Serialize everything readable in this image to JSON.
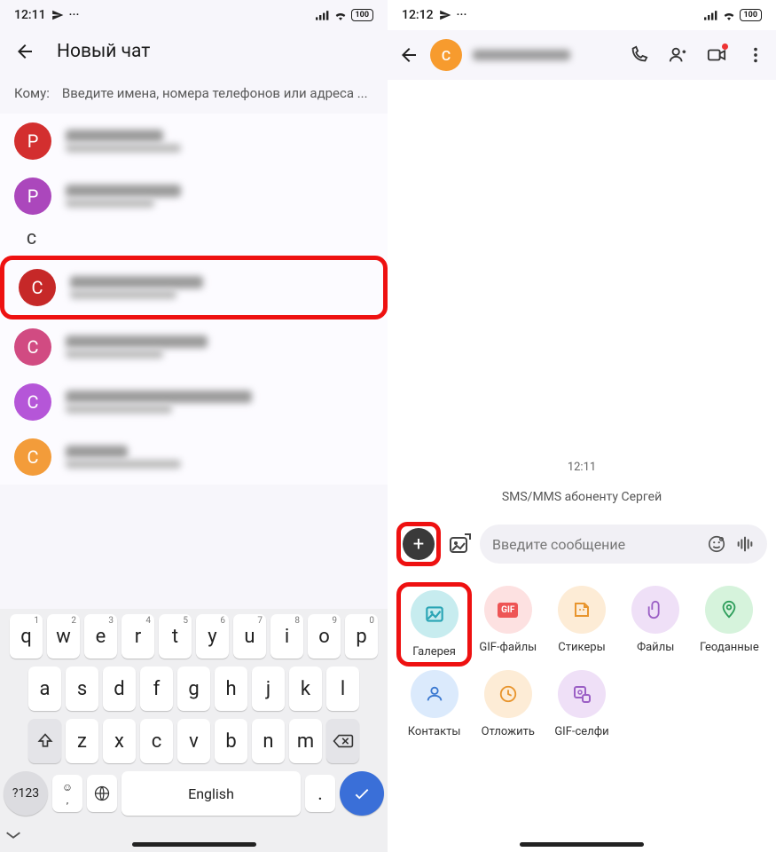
{
  "left": {
    "status": {
      "time": "12:11",
      "battery": "100"
    },
    "header": {
      "title": "Новый чат"
    },
    "to": {
      "label": "Кому:",
      "placeholder": "Введите имена, номера телефонов или адреса ..."
    },
    "section_letter": "С",
    "contacts": [
      {
        "letter": "Р",
        "color": "#d32f2f"
      },
      {
        "letter": "Р",
        "color": "#ab47bc"
      },
      {
        "letter": "С",
        "color": "#c62828",
        "highlight": true
      },
      {
        "letter": "С",
        "color": "#d14b82"
      },
      {
        "letter": "С",
        "color": "#b556d8"
      },
      {
        "letter": "С",
        "color": "#f39c3a"
      }
    ],
    "keyboard": {
      "row1": [
        "q",
        "w",
        "e",
        "r",
        "t",
        "y",
        "u",
        "i",
        "o",
        "p"
      ],
      "row1_sup": [
        "1",
        "2",
        "3",
        "4",
        "5",
        "6",
        "7",
        "8",
        "9",
        "0"
      ],
      "row2": [
        "a",
        "s",
        "d",
        "f",
        "g",
        "h",
        "j",
        "k",
        "l"
      ],
      "row3": [
        "z",
        "x",
        "c",
        "v",
        "b",
        "n",
        "m"
      ],
      "lang": "English",
      "num_key": "?123"
    }
  },
  "right": {
    "status": {
      "time": "12:12",
      "battery": "100"
    },
    "avatar_letter": "С",
    "chat": {
      "time": "12:11",
      "info": "SMS/MMS абоненту Сергей"
    },
    "input": {
      "placeholder": "Введите сообщение"
    },
    "attachments": [
      {
        "label": "Галерея",
        "bg": "#c7ecef",
        "highlight": true
      },
      {
        "label": "GIF-файлы",
        "bg": "#fde1e1"
      },
      {
        "label": "Стикеры",
        "bg": "#fdecd6"
      },
      {
        "label": "Файлы",
        "bg": "#efe0f7"
      },
      {
        "label": "Геоданные",
        "bg": "#d6f3dc"
      },
      {
        "label": "Контакты",
        "bg": "#dbeafc"
      },
      {
        "label": "Отложить",
        "bg": "#fdecd6"
      },
      {
        "label": "GIF-селфи",
        "bg": "#efe0f7"
      }
    ]
  }
}
